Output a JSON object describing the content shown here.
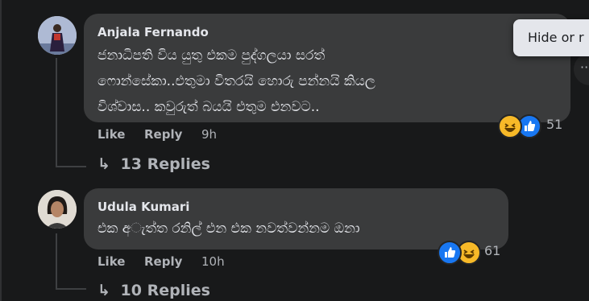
{
  "tooltip": {
    "text": "Hide or r"
  },
  "comments": [
    {
      "author": "Anjala Fernando",
      "lines": [
        "ජනාධිපති විය යුතු එකම පුද්ගලයා සරත්",
        "ෆොන්සේකා..එතුමා විතරයි හොරු පන්නයි කියල",
        "විශ්වාස.. කවුරුත් බයයි එතුම එනවට.."
      ],
      "like": "Like",
      "reply": "Reply",
      "time": "9h",
      "reaction_count": "51",
      "reactions": [
        "haha",
        "like"
      ],
      "replies_label": "13 Replies"
    },
    {
      "author": "Udula Kumari",
      "lines": [
        "එක අ◌ැත්ත රනිල් එන එක නවත්වන්නම ඔනා"
      ],
      "like": "Like",
      "reply": "Reply",
      "time": "10h",
      "reaction_count": "61",
      "reactions": [
        "like",
        "haha"
      ],
      "replies_label": "10 Replies"
    }
  ],
  "colors": {
    "background": "#18191a",
    "bubble": "#3a3b3c",
    "like_blue": "#1877f2",
    "haha_yellow": "#f7b928"
  }
}
